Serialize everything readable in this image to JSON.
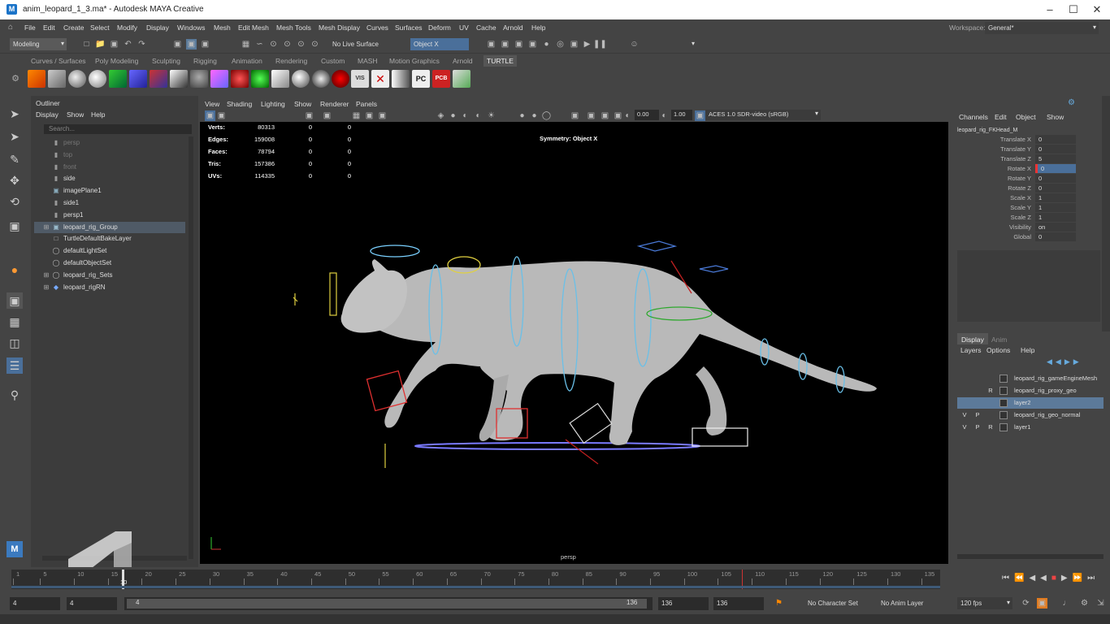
{
  "window": {
    "title": "anim_leopard_1_3.ma* - Autodesk MAYA Creative",
    "app_icon": "M"
  },
  "menubar": {
    "items": [
      "File",
      "Edit",
      "Create",
      "Select",
      "Modify",
      "Display",
      "Windows",
      "Mesh",
      "Edit Mesh",
      "Mesh Tools",
      "Mesh Display",
      "Curves",
      "Surfaces",
      "Deform",
      "UV",
      "Cache",
      "Arnold",
      "Help"
    ],
    "workspace_label": "Workspace:",
    "workspace_value": "General*"
  },
  "statusline": {
    "menuset": "Modeling",
    "live_surface": "No Live Surface",
    "symmetry": "Object X"
  },
  "shelf": {
    "tabs": [
      "Curves / Surfaces",
      "Poly Modeling",
      "Sculpting",
      "Rigging",
      "Animation",
      "Rendering",
      "Custom",
      "MASH",
      "Motion Graphics",
      "Arnold",
      "TURTLE"
    ],
    "active_tab": "TURTLE"
  },
  "outliner": {
    "title": "Outliner",
    "menu": [
      "Display",
      "Show",
      "Help"
    ],
    "search_placeholder": "Search...",
    "items": [
      {
        "label": "persp",
        "icon": "camera-icon",
        "dim": true
      },
      {
        "label": "top",
        "icon": "camera-icon",
        "dim": true
      },
      {
        "label": "front",
        "icon": "camera-icon",
        "dim": true
      },
      {
        "label": "side",
        "icon": "camera-icon",
        "dim": false
      },
      {
        "label": "imagePlane1",
        "icon": "image-plane-icon",
        "dim": false
      },
      {
        "label": "side1",
        "icon": "camera-icon",
        "dim": false
      },
      {
        "label": "persp1",
        "icon": "camera-icon",
        "dim": false
      },
      {
        "label": "leopard_rig_Group",
        "icon": "group-icon",
        "dim": false,
        "selected": true
      },
      {
        "label": "TurtleDefaultBakeLayer",
        "icon": "bake-layer-icon",
        "dim": false
      },
      {
        "label": "defaultLightSet",
        "icon": "set-icon",
        "dim": false
      },
      {
        "label": "defaultObjectSet",
        "icon": "set-icon",
        "dim": false
      },
      {
        "label": "leopard_rig_Sets",
        "icon": "set-icon",
        "dim": false
      },
      {
        "label": "leopard_rigRN",
        "icon": "reference-icon",
        "dim": false
      }
    ]
  },
  "viewport": {
    "menu": [
      "View",
      "Shading",
      "Lighting",
      "Show",
      "Renderer",
      "Panels"
    ],
    "exposure": "0.00",
    "gamma": "1.00",
    "color_space": "ACES 1.0 SDR-video (sRGB)",
    "symmetry_label": "Symmetry: Object X",
    "camera_label": "persp",
    "hud": [
      {
        "label": "Verts:",
        "v1": "80313",
        "v2": "0",
        "v3": "0"
      },
      {
        "label": "Edges:",
        "v1": "159008",
        "v2": "0",
        "v3": "0"
      },
      {
        "label": "Faces:",
        "v1": "78794",
        "v2": "0",
        "v3": "0"
      },
      {
        "label": "Tris:",
        "v1": "157386",
        "v2": "0",
        "v3": "0"
      },
      {
        "label": "UVs:",
        "v1": "114335",
        "v2": "0",
        "v3": "0"
      }
    ]
  },
  "channelbox": {
    "menu": [
      "Channels",
      "Edit",
      "Object",
      "Show"
    ],
    "node": "leopard_rig_FKHead_M",
    "channels": [
      {
        "label": "Translate X",
        "value": "0"
      },
      {
        "label": "Translate Y",
        "value": "0"
      },
      {
        "label": "Translate Z",
        "value": "5"
      },
      {
        "label": "Rotate X",
        "value": "0",
        "highlight": true
      },
      {
        "label": "Rotate Y",
        "value": "0"
      },
      {
        "label": "Rotate Z",
        "value": "0"
      },
      {
        "label": "Scale X",
        "value": "1"
      },
      {
        "label": "Scale Y",
        "value": "1"
      },
      {
        "label": "Scale Z",
        "value": "1"
      },
      {
        "label": "Visibility",
        "value": "on"
      },
      {
        "label": "Global",
        "value": "0"
      }
    ]
  },
  "layers": {
    "tabs": [
      "Display",
      "Anim"
    ],
    "menu": [
      "Layers",
      "Options",
      "Help"
    ],
    "items": [
      {
        "v": "",
        "p": "",
        "r": "",
        "name": "leopard_rig_gameEngineMesh"
      },
      {
        "v": "",
        "p": "",
        "r": "R",
        "name": "leopard_rig_proxy_geo"
      },
      {
        "v": "",
        "p": "",
        "r": "",
        "name": "layer2",
        "selected": true
      },
      {
        "v": "V",
        "p": "P",
        "r": "",
        "name": "leopard_rig_geo_normal"
      },
      {
        "v": "V",
        "p": "P",
        "r": "R",
        "name": "layer1"
      }
    ]
  },
  "timeline": {
    "ticks": [
      "1",
      "5",
      "10",
      "15",
      "20",
      "25",
      "30",
      "35",
      "40",
      "45",
      "50",
      "55",
      "60",
      "65",
      "70",
      "75",
      "80",
      "85",
      "90",
      "95",
      "100",
      "105",
      "110",
      "115",
      "120",
      "125",
      "130",
      "135"
    ],
    "current_frame": "10"
  },
  "range": {
    "start": "4",
    "playback_start": "4",
    "slider_start": "4",
    "slider_end": "136",
    "playback_end": "136",
    "end": "136",
    "character_set": "No Character Set",
    "anim_layer": "No Anim Layer",
    "fps": "120 fps"
  }
}
